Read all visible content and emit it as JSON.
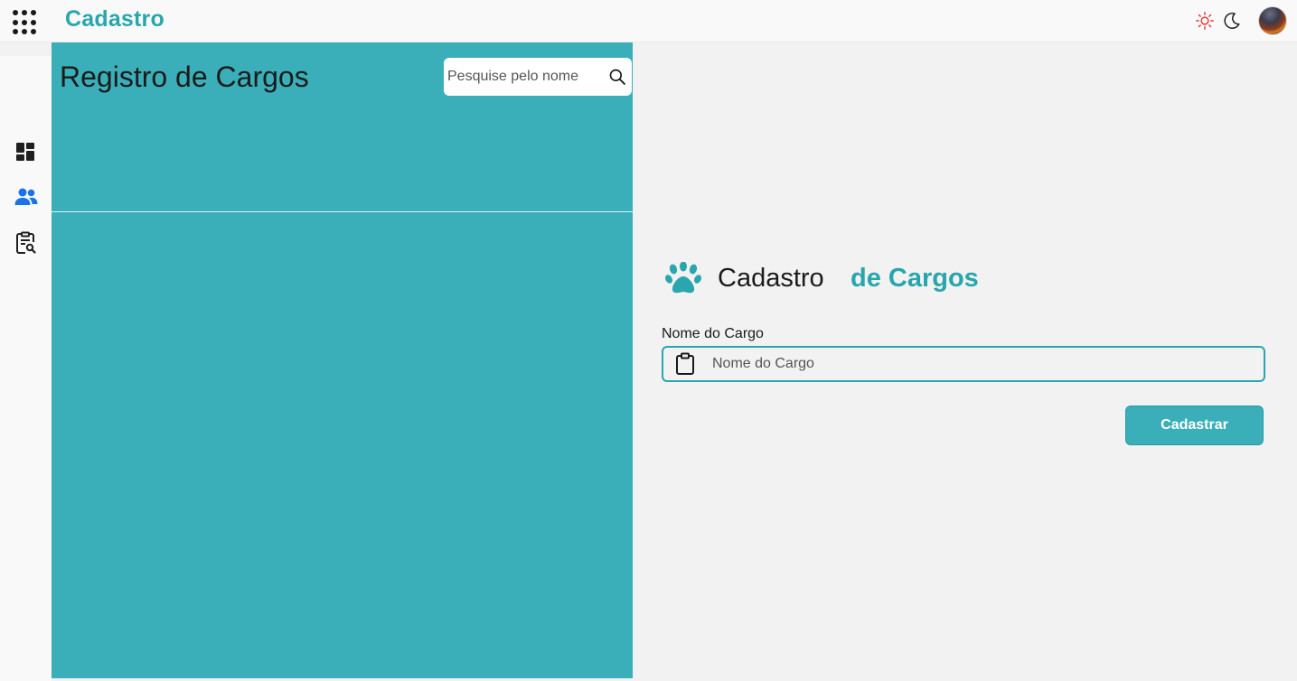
{
  "header": {
    "app_title": "Cadastro",
    "apps_icon": "apps-grid-icon",
    "theme_light_icon": "sun-icon",
    "theme_dark_icon": "moon-icon",
    "avatar": "user-avatar"
  },
  "sidebar": {
    "items": [
      {
        "icon": "dashboard-icon"
      },
      {
        "icon": "users-icon",
        "active": true
      },
      {
        "icon": "clipboard-search-icon"
      }
    ]
  },
  "registry": {
    "title": "Registro de Cargos",
    "search_placeholder": "Pesquise pelo nome"
  },
  "form": {
    "heading_part1": "Cadastro",
    "heading_part2": "de Cargos",
    "field_label": "Nome do Cargo",
    "field_placeholder": "Nome do Cargo",
    "submit_label": "Cadastrar"
  },
  "colors": {
    "accent": "#28a6ae",
    "panel": "#3aafb9",
    "active_icon": "#1a73e8",
    "sun": "#e53935"
  }
}
